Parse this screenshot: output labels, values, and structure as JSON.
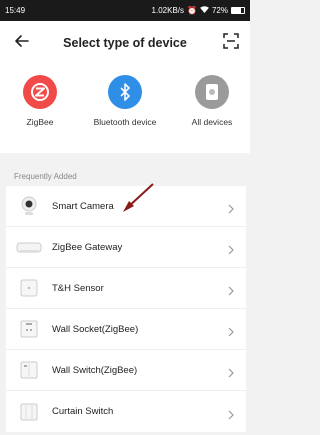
{
  "status_bar": {
    "time": "15:49",
    "speed": "1.02KB/s",
    "icons": [
      "alarm-icon",
      "wifi-icon"
    ],
    "battery_label": "72%",
    "battery_level": 0.72
  },
  "header": {
    "title": "Select type of device",
    "back_icon": "back-arrow-icon",
    "scan_icon": "scan-icon"
  },
  "categories": [
    {
      "label": "ZigBee",
      "icon": "zigbee-icon",
      "color": "#f04b48"
    },
    {
      "label": "Bluetooth device",
      "icon": "bluetooth-icon",
      "color": "#2f8ee6"
    },
    {
      "label": "All devices",
      "icon": "all-devices-icon",
      "color": "#9b9b9b"
    }
  ],
  "frequently_added": {
    "title": "Frequently Added",
    "items": [
      {
        "label": "Smart Camera",
        "icon": "smart-camera-icon"
      },
      {
        "label": "ZigBee Gateway",
        "icon": "zigbee-gateway-icon"
      },
      {
        "label": "T&H Sensor",
        "icon": "th-sensor-icon"
      },
      {
        "label": "Wall Socket(ZigBee)",
        "icon": "wall-socket-icon"
      },
      {
        "label": "Wall Switch(ZigBee)",
        "icon": "wall-switch-icon"
      },
      {
        "label": "Curtain Switch",
        "icon": "curtain-switch-icon"
      }
    ]
  },
  "colors": {
    "annotation_arrow": "#8b1a1a"
  }
}
